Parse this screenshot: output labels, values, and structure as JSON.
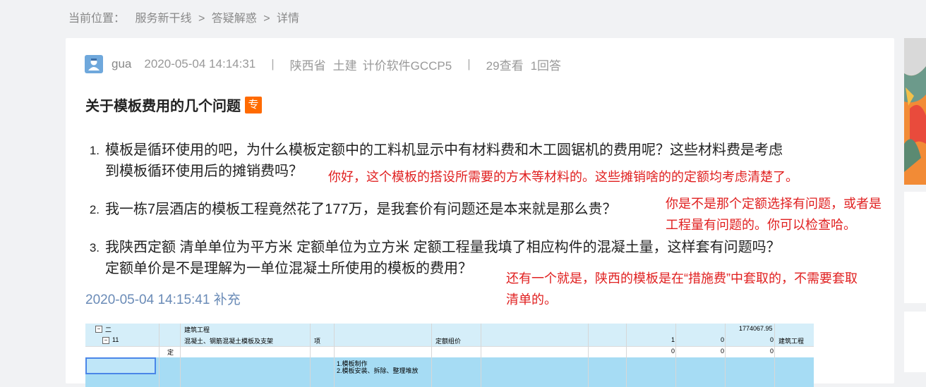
{
  "breadcrumb": {
    "label": "当前位置：",
    "items": [
      "服务新干线",
      "答疑解惑",
      "详情"
    ],
    "separator": ">"
  },
  "meta": {
    "user": "gua",
    "datetime": "2020-05-04 14:14:31",
    "divider": "|",
    "province": "陕西省",
    "discipline": "土建",
    "software": "计价软件GCCP5",
    "views": "29查看",
    "answers": "1回答"
  },
  "title": "关于模板费用的几个问题",
  "badge": "专",
  "questions": [
    {
      "num": "1.",
      "line1": "模板是循环使用的吧，为什么模板定额中的工料机显示中有材料费和木工圆锯机的费用呢？这些材料费是考虑",
      "line2": "到模板循环使用后的摊销费吗？"
    },
    {
      "num": "2.",
      "line1": "我一栋7层酒店的模板工程竟然花了177万，是我套价有问题还是本来就是那么贵？"
    },
    {
      "num": "3.",
      "line1": "我陕西定额 清单单位为平方米 定额单位为立方米  定额工程量我填了相应构件的混凝土量，这样套有问题吗？",
      "line2": "定额单价是不是理解为一单位混凝土所使用的模板的费用？"
    }
  ],
  "notes": {
    "n1": "你好，这个模板的搭设所需要的方木等材料的。这些摊销啥的的定额均考虑清楚了。",
    "n2_line1": "你是不是那个定额选择有问题，或者是",
    "n2_line2": "工程量有问题的。你可以检查哈。",
    "n3_line1": "还有一个就是，陕西的模板是在“措施费”中套取的，不需要套取",
    "n3_line2": "清单的。"
  },
  "supplement": {
    "datetime": "2020-05-04 14:15:41",
    "label": "补充"
  },
  "sheet": {
    "rows": [
      {
        "code": "二",
        "name": "建筑工程",
        "total": "1774067.95"
      },
      {
        "code": "11",
        "name": "混凝土、钢筋混凝土模板及支架",
        "unit": "项",
        "type": "定额组价",
        "c1": "1",
        "c2": "0",
        "c3": "0",
        "tail": "建筑工程"
      },
      {
        "kind": "定",
        "c1": "0",
        "c2": "0",
        "c3": "0"
      },
      {
        "desc1": "1.模板制作",
        "desc2": "2.模板安装、拆除、整理堆放"
      }
    ]
  },
  "colors": {
    "accent_red": "#e02020",
    "badge_orange": "#ff6a00",
    "supplement_blue": "#6a8bb7",
    "sheet_highlight": "#d5eef9"
  }
}
